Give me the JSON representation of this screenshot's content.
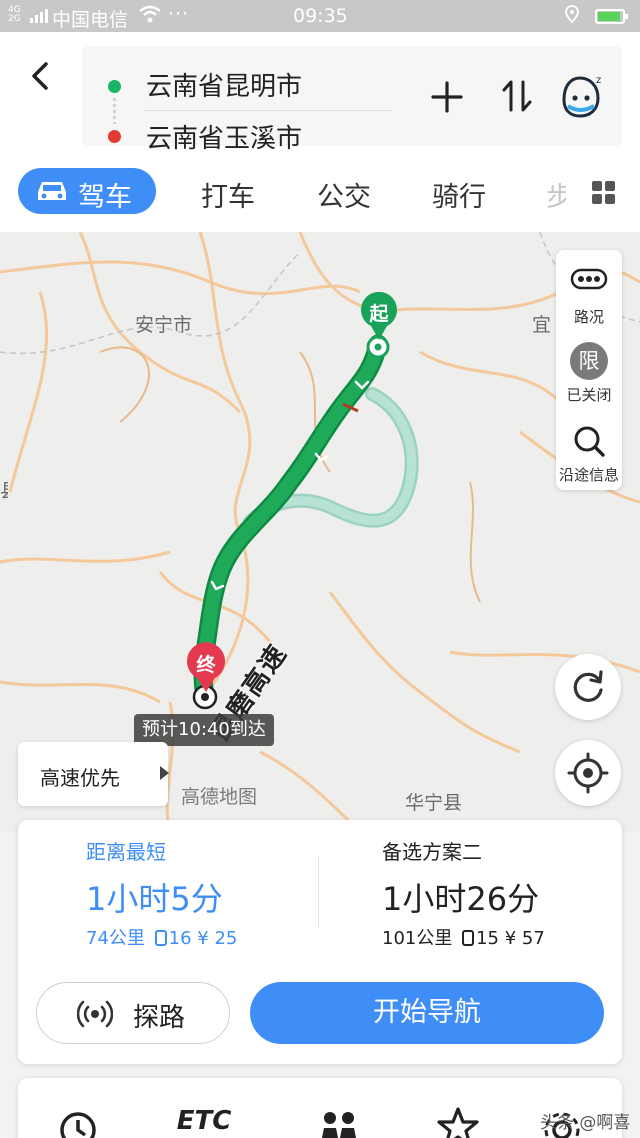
{
  "status_bar": {
    "network": "4G\n2G",
    "carrier": "中国电信",
    "more": "···",
    "time": "09:35"
  },
  "route": {
    "origin": "云南省昆明市",
    "destination": "云南省玉溪市"
  },
  "tabs": {
    "active": "驾车",
    "items": [
      "打车",
      "公交",
      "骑行",
      "步"
    ]
  },
  "map": {
    "labels": {
      "anning": "安宁市",
      "yi": "宜",
      "xian": "县",
      "huaning": "华宁县"
    },
    "road_name": "昆磨高速",
    "start_pin": "起",
    "end_pin": "终",
    "eta": "预计10:40到达",
    "preference": "高速优先",
    "watermark": "高德地图"
  },
  "side_panel": {
    "traffic": "路况",
    "restriction_glyph": "限",
    "restriction": "已关闭",
    "along_route": "沿途信息"
  },
  "plans": {
    "primary": {
      "title": "距离最短",
      "duration": "1小时5分",
      "distance": "74公里",
      "lights": "16",
      "toll": "¥ 25"
    },
    "secondary": {
      "title": "备选方案二",
      "duration": "1小时26分",
      "distance": "101公里",
      "lights": "15",
      "toll": "¥ 57"
    }
  },
  "buttons": {
    "explore": "探路",
    "start_navigation": "开始导航"
  },
  "bottom": {
    "etc": "ETC",
    "credit": "头条 @啊喜"
  },
  "colors": {
    "accent": "#3f8ef7",
    "route_green": "#1faa5a",
    "alt_route": "#9ad3c0",
    "end_pin": "#e53950"
  }
}
